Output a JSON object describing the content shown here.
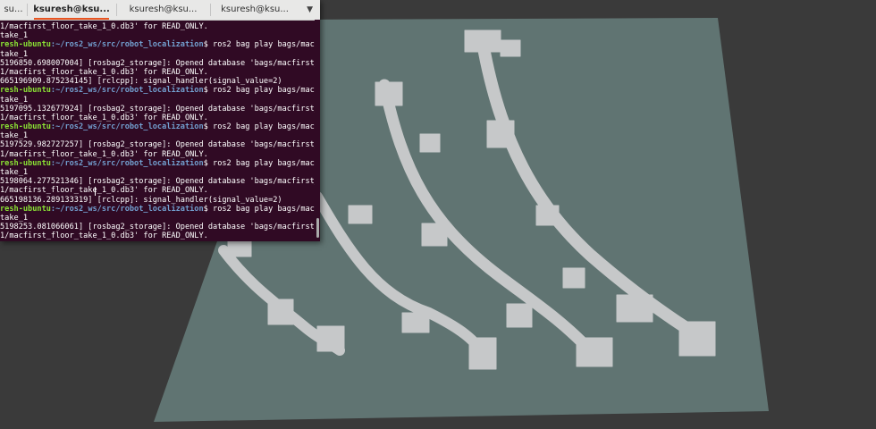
{
  "colors": {
    "background": "#3a3a3a",
    "map_plane": "#607472",
    "map_shape": "#c6c8c9",
    "terminal_bg": "#300a24",
    "prompt_user": "#8ae234",
    "prompt_path": "#729fcf"
  },
  "terminal": {
    "tabs": [
      {
        "label": "su...",
        "active": false
      },
      {
        "label": "ksuresh@ksu...",
        "active": true
      },
      {
        "label": "ksuresh@ksu...",
        "active": false
      },
      {
        "label": "ksuresh@ksu...",
        "active": false
      }
    ],
    "menu_icon": "chevron-down-icon",
    "lines": [
      {
        "text": "1/macfirst_floor_take_1_0.db3' for READ_ONLY."
      },
      {
        "text": "take_1"
      },
      {
        "user": "resh-ubuntu",
        "path": ":~/ros2_ws/src/robot_localization",
        "text": "$ ros2 bag play bags/macf"
      },
      {
        "text": "take_1"
      },
      {
        "text": "5196850.698007004] [rosbag2_storage]: Opened database 'bags/macfirst_"
      },
      {
        "text": "1/macfirst_floor_take_1_0.db3' for READ_ONLY."
      },
      {
        "text": "665196909.875234145] [rclcpp]: signal_handler(signal_value=2)"
      },
      {
        "user": "resh-ubuntu",
        "path": ":~/ros2_ws/src/robot_localization",
        "text": "$ ros2 bag play bags/macf"
      },
      {
        "text": "take_1"
      },
      {
        "text": "5197095.132677924] [rosbag2_storage]: Opened database 'bags/macfirst_"
      },
      {
        "text": "1/macfirst_floor_take_1_0.db3' for READ_ONLY."
      },
      {
        "user": "resh-ubuntu",
        "path": ":~/ros2_ws/src/robot_localization",
        "text": "$ ros2 bag play bags/macf"
      },
      {
        "text": "take_1"
      },
      {
        "text": "5197529.982727257] [rosbag2_storage]: Opened database 'bags/macfirst_"
      },
      {
        "text": "1/macfirst_floor_take_1_0.db3' for READ_ONLY."
      },
      {
        "user": "resh-ubuntu",
        "path": ":~/ros2_ws/src/robot_localization",
        "text": "$ ros2 bag play bags/macf"
      },
      {
        "text": "take_1"
      },
      {
        "text": "5198064.277521346] [rosbag2_storage]: Opened database 'bags/macfirst_"
      },
      {
        "text": "1/macfirst_floor_take_1_0.db3' for READ_ONLY."
      },
      {
        "text": "665198136.289133319] [rclcpp]: signal_handler(signal_value=2)"
      },
      {
        "user": "resh-ubuntu",
        "path": ":~/ros2_ws/src/robot_localization",
        "text": "$ ros2 bag play bags/macf"
      },
      {
        "text": "take_1"
      },
      {
        "text": "5198253.081066061] [rosbag2_storage]: Opened database 'bags/macfirst_"
      },
      {
        "text": "1/macfirst_floor_take_1_0.db3' for READ_ONLY."
      }
    ]
  }
}
